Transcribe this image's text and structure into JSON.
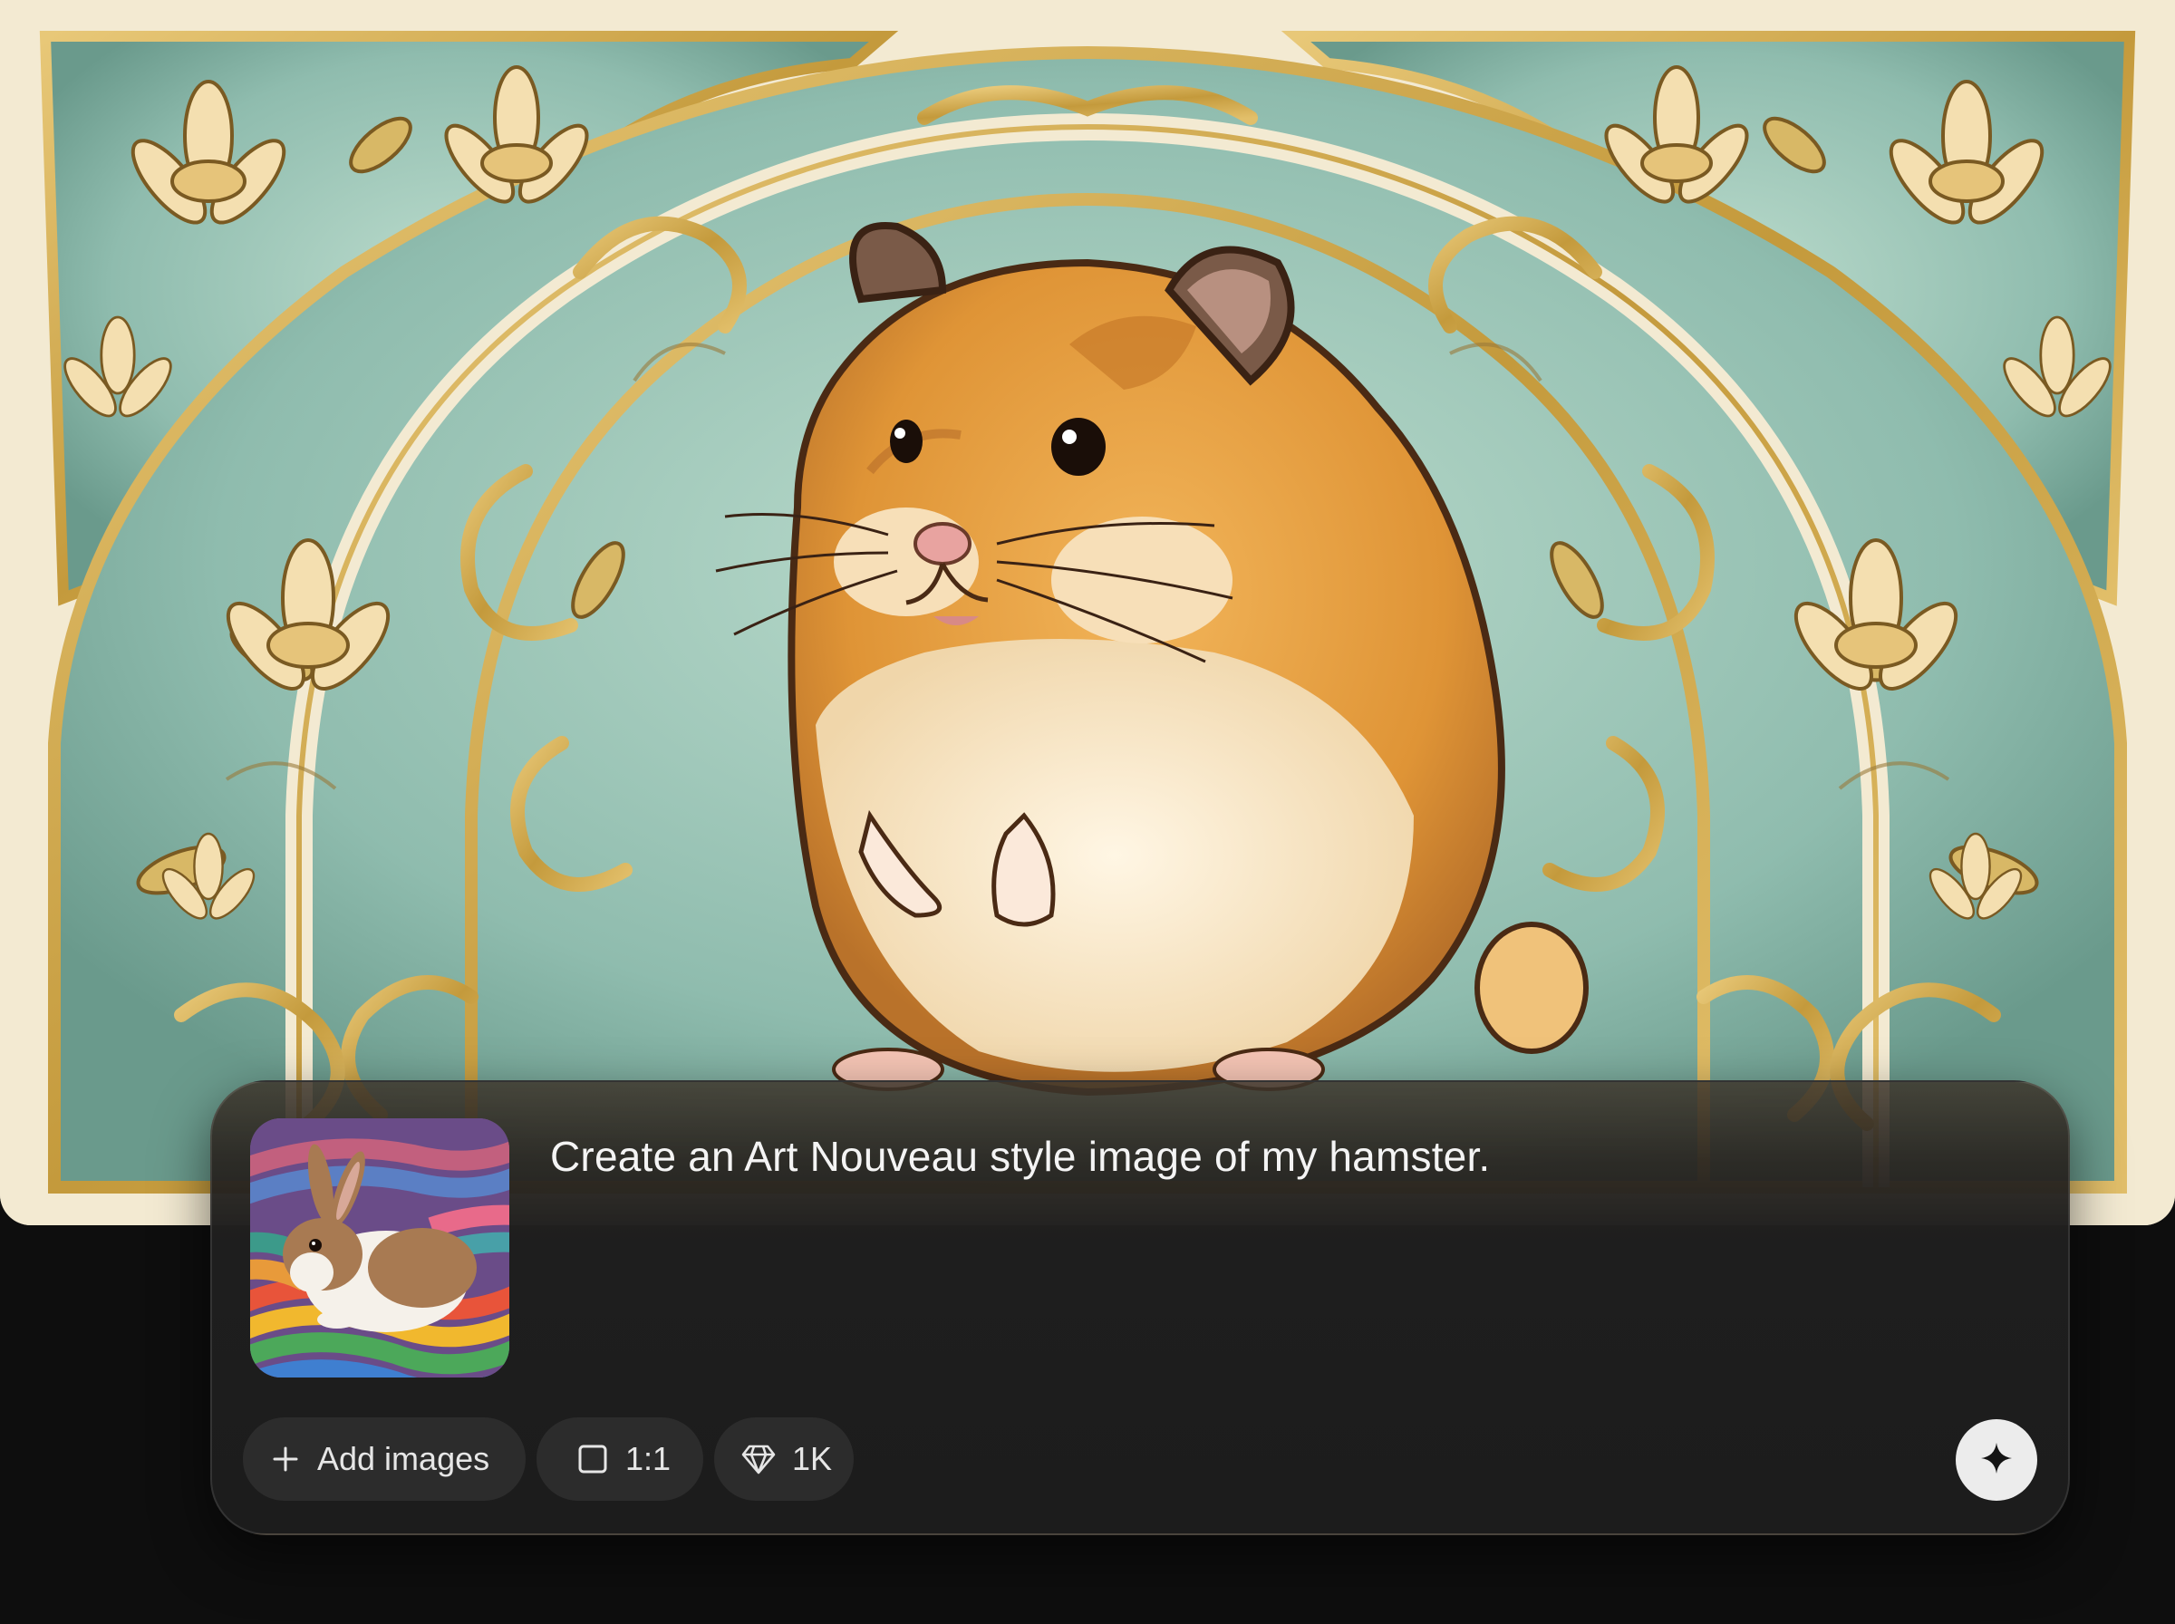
{
  "artwork": {
    "description_icon": "art-nouveau-hamster-image"
  },
  "reference_image": {
    "icon": "rabbit-on-crochet-blanket-thumbnail"
  },
  "prompt": {
    "text": "Create an Art Nouveau style image of my hamster."
  },
  "toolbar": {
    "add_images_label": "Add images",
    "aspect_ratio_label": "1:1",
    "resolution_label": "1K",
    "add_icon": "plus-icon",
    "aspect_icon": "square-icon",
    "resolution_icon": "diamond-icon",
    "generate_icon": "sparkle-icon"
  },
  "colors": {
    "page_background": "#0e0e0e",
    "panel_background": "#1c1c1c",
    "chip_background": "#2c2c2c",
    "text_primary": "#f4f4f4",
    "button_light": "#ececec"
  }
}
